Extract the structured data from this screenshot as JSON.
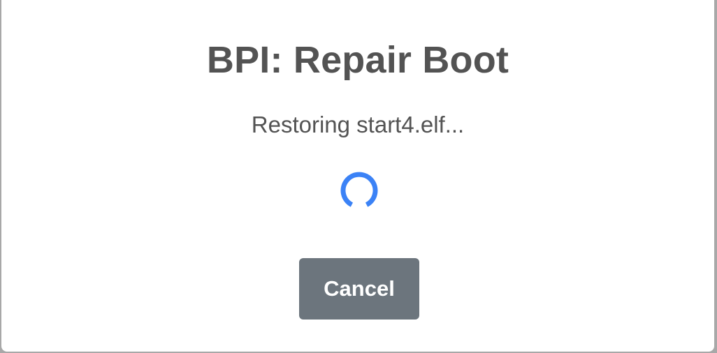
{
  "dialog": {
    "title": "BPI: Repair Boot",
    "status": "Restoring start4.elf...",
    "spinner": {
      "icon": "loading-spinner-icon",
      "color": "#3b82f6"
    },
    "cancel_label": "Cancel"
  },
  "colors": {
    "text": "#535353",
    "button_bg": "#6c757d",
    "button_text": "#ffffff",
    "spinner": "#3b82f6"
  }
}
